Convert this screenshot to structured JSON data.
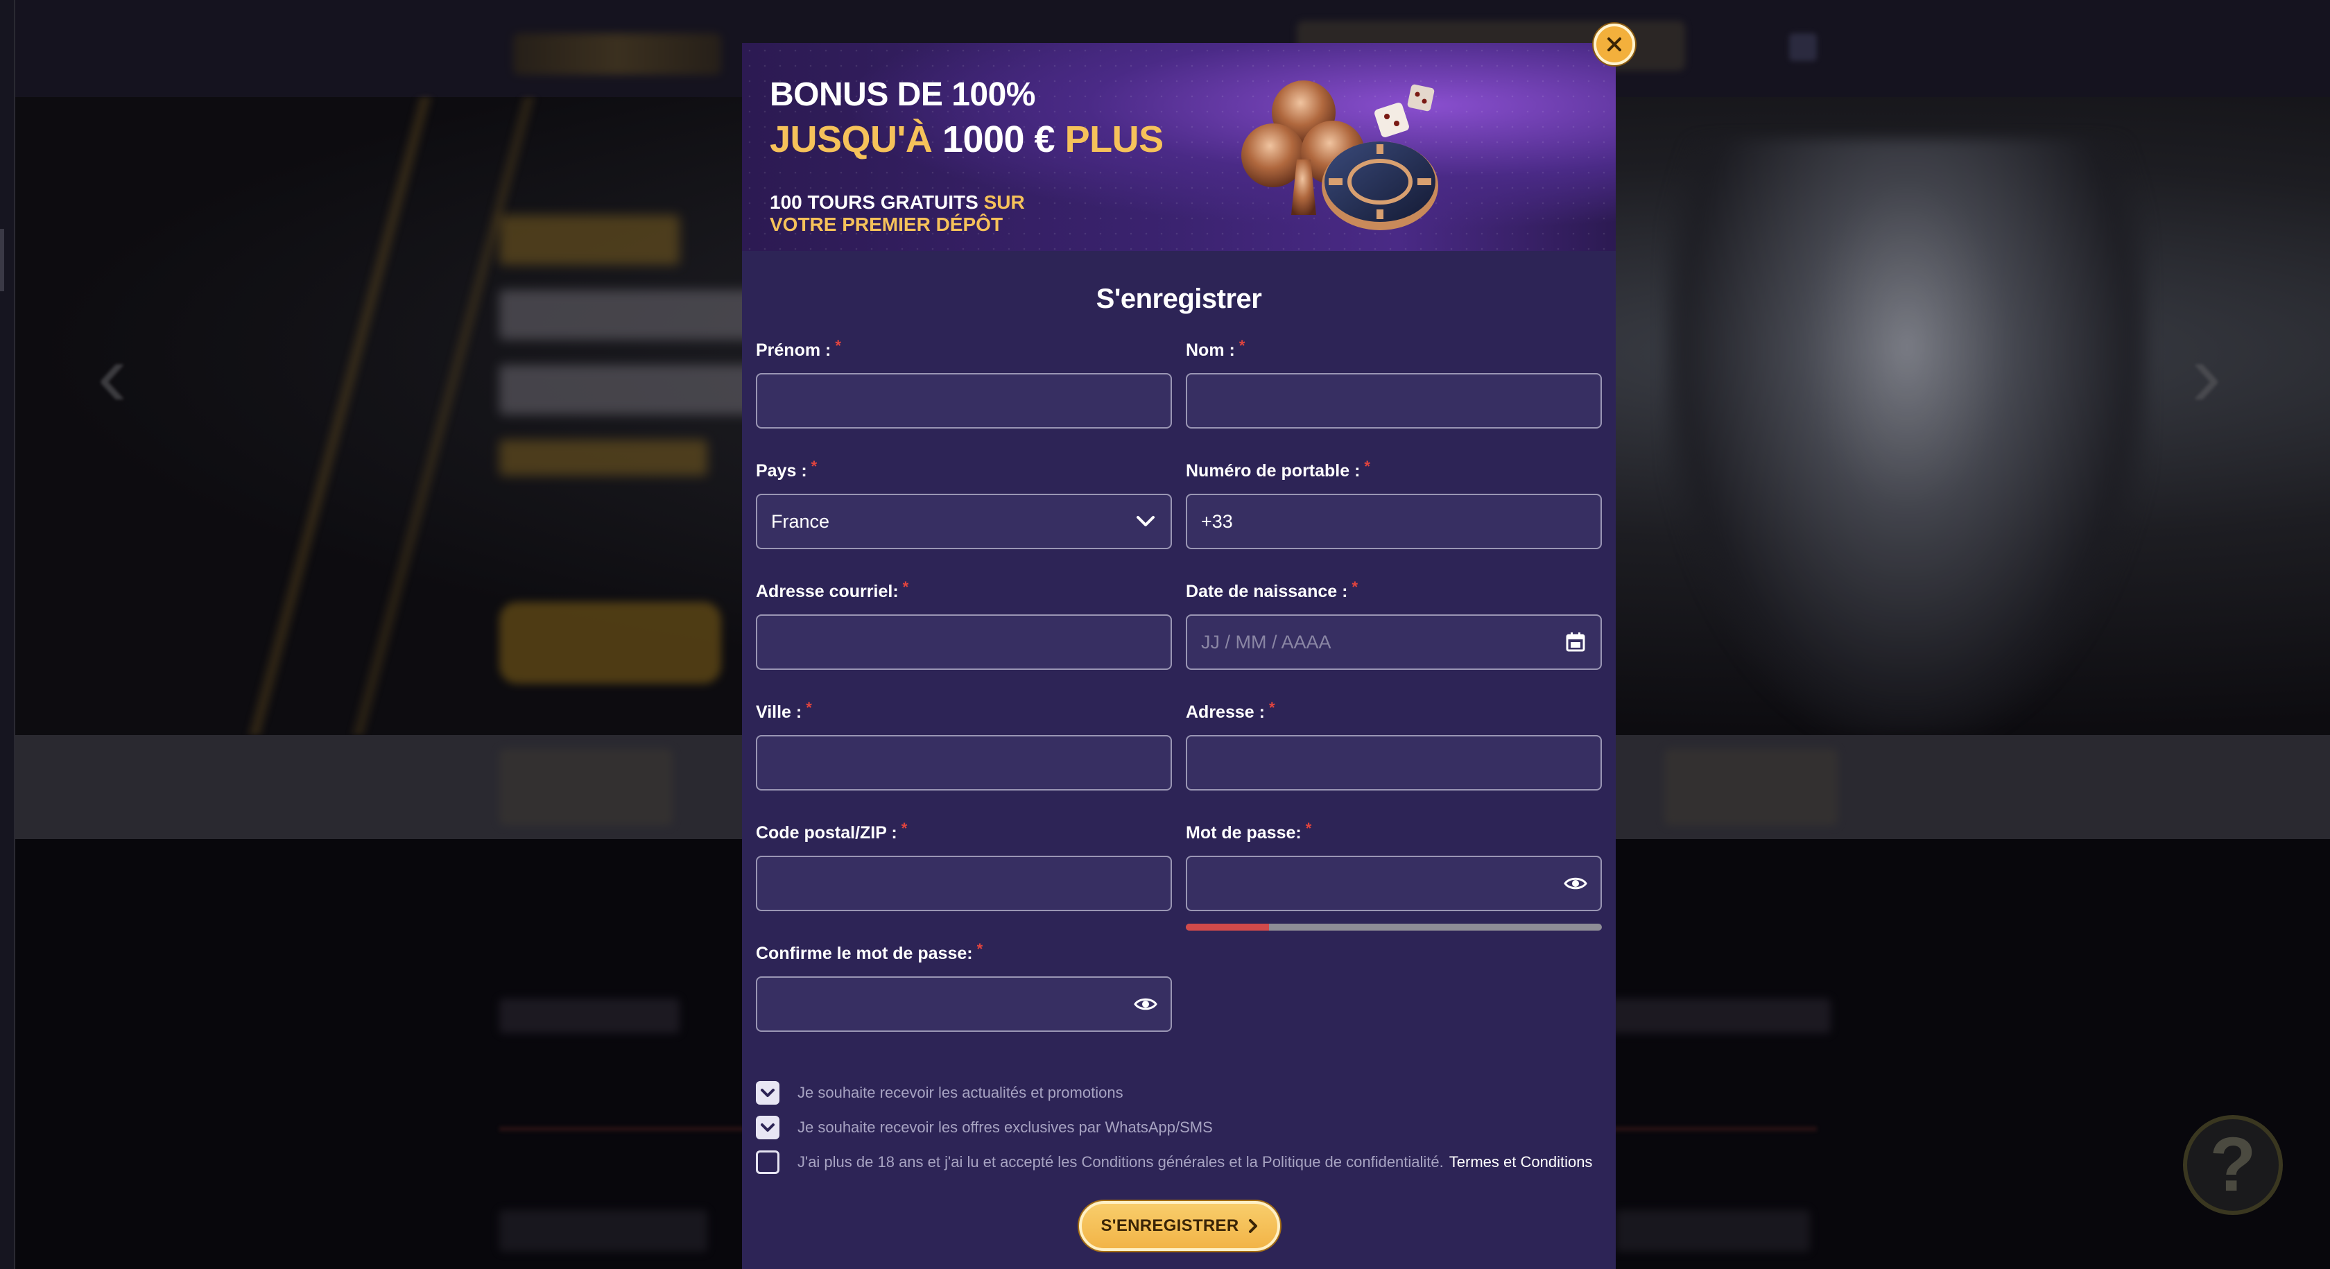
{
  "banner": {
    "line1": "BONUS DE 100%",
    "line2_gold": "JUSQU'À",
    "line2_white": "1000 €",
    "line2_gold2": "PLUS",
    "line3_white": "100 TOURS GRATUITS",
    "line3_gold": "SUR",
    "line4_gold": "VOTRE PREMIER DÉPÔT"
  },
  "form": {
    "title": "S'enregistrer",
    "required_mark": "*",
    "fields": {
      "first_name": {
        "label": "Prénom :",
        "value": ""
      },
      "last_name": {
        "label": "Nom :",
        "value": ""
      },
      "country": {
        "label": "Pays :",
        "value": "France"
      },
      "mobile": {
        "label": "Numéro de portable :",
        "value": "+33"
      },
      "email": {
        "label": "Adresse courriel:",
        "value": ""
      },
      "birthdate": {
        "label": "Date de naissance :",
        "placeholder": "JJ / MM / AAAA"
      },
      "city": {
        "label": "Ville :",
        "value": ""
      },
      "address": {
        "label": "Adresse :",
        "value": ""
      },
      "zip": {
        "label": "Code postal/ZIP :",
        "value": ""
      },
      "password": {
        "label": "Mot de passe:",
        "value": "",
        "strength": 0.2
      },
      "confirm_password": {
        "label": "Confirme le mot de passe:",
        "value": ""
      }
    },
    "checkboxes": {
      "news": {
        "label": "Je souhaite recevoir les actualités et promotions",
        "checked": true
      },
      "whatsapp": {
        "label": "Je souhaite recevoir les offres exclusives par WhatsApp/SMS",
        "checked": true
      },
      "terms": {
        "label": "J'ai plus de 18 ans et j'ai lu et accepté les Conditions générales et la Politique de confidentialité.",
        "link": "Termes et Conditions",
        "checked": false
      }
    },
    "submit_label": "S'ENREGISTRER"
  },
  "help": {
    "label": "?"
  },
  "icons": {
    "close": "close-icon",
    "dropdown": "chevron-down-icon",
    "calendar": "calendar-icon",
    "eye": "eye-icon",
    "check": "check-icon",
    "submit_chevron": "chevron-right-icon"
  },
  "colors": {
    "modal_bg": "#2d2456",
    "input_bg": "#372f62",
    "gold": "#f6c25a",
    "required": "#e2443e",
    "strength_weak": "#d24a4a",
    "button": "#f2b447"
  }
}
